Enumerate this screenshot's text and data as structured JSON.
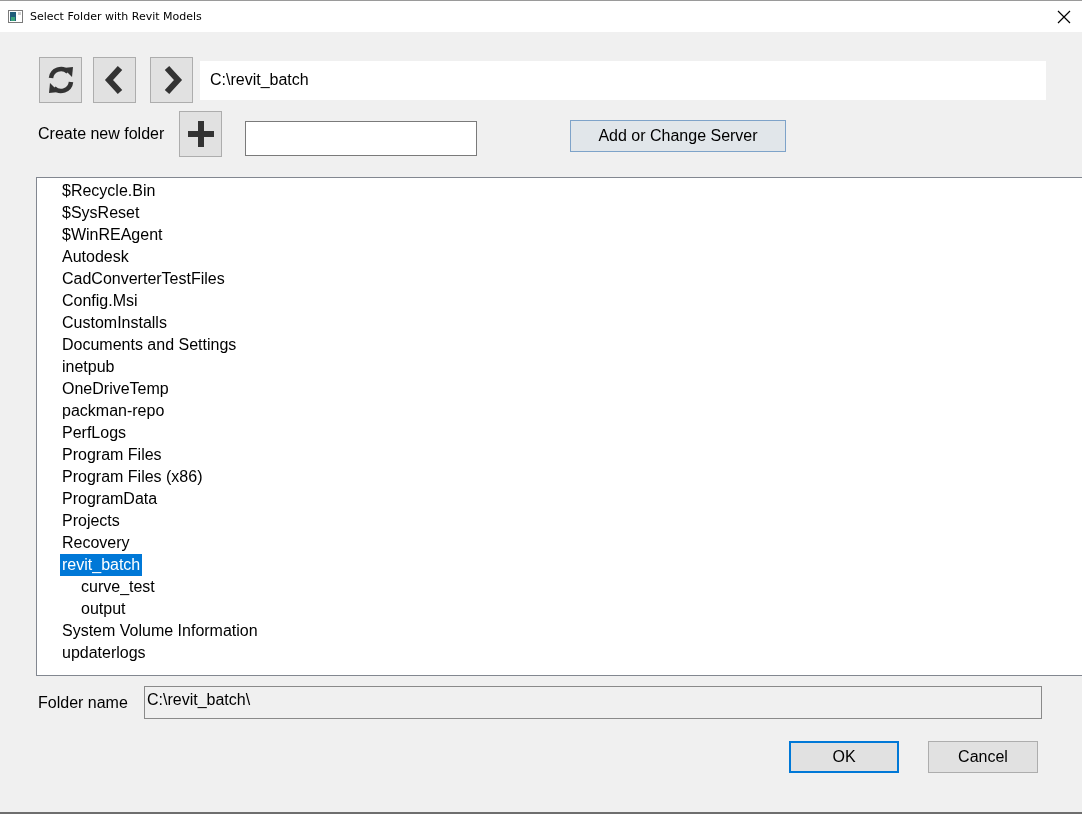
{
  "window": {
    "title": "Select Folder with Revit Models"
  },
  "navigation": {
    "path": "C:\\revit_batch"
  },
  "create_folder": {
    "label": "Create new folder"
  },
  "server_button": {
    "label": "Add or Change Server"
  },
  "folder_tree": [
    {
      "label": "$Recycle.Bin",
      "selected": false
    },
    {
      "label": "$SysReset",
      "selected": false
    },
    {
      "label": "$WinREAgent",
      "selected": false
    },
    {
      "label": "Autodesk",
      "selected": false
    },
    {
      "label": "CadConverterTestFiles",
      "selected": false
    },
    {
      "label": "Config.Msi",
      "selected": false
    },
    {
      "label": "CustomInstalls",
      "selected": false
    },
    {
      "label": "Documents and Settings",
      "selected": false
    },
    {
      "label": "inetpub",
      "selected": false
    },
    {
      "label": "OneDriveTemp",
      "selected": false
    },
    {
      "label": "packman-repo",
      "selected": false
    },
    {
      "label": "PerfLogs",
      "selected": false
    },
    {
      "label": "Program Files",
      "selected": false
    },
    {
      "label": "Program Files (x86)",
      "selected": false
    },
    {
      "label": "ProgramData",
      "selected": false
    },
    {
      "label": "Projects",
      "selected": false
    },
    {
      "label": "Recovery",
      "selected": false
    },
    {
      "label": "revit_batch",
      "selected": true,
      "children": [
        {
          "label": "curve_test",
          "selected": false
        },
        {
          "label": "output",
          "selected": false
        }
      ]
    },
    {
      "label": "System Volume Information",
      "selected": false
    },
    {
      "label": "updaterlogs",
      "selected": false
    }
  ],
  "folder_name": {
    "label": "Folder name",
    "value": "C:\\revit_batch\\",
    "read_only": true
  },
  "buttons": [
    {
      "label": "OK",
      "default": true
    },
    {
      "label": "Cancel",
      "default": false
    }
  ]
}
